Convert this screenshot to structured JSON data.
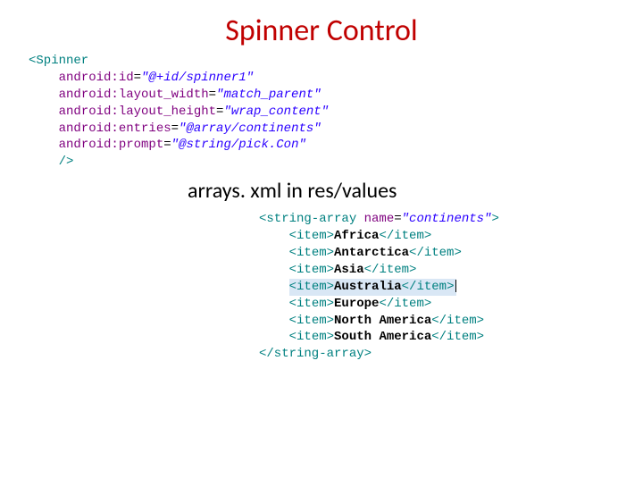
{
  "title": "Spinner Control",
  "subtitle": "arrays. xml in res/values",
  "spinner": {
    "open": "<Spinner",
    "attrs": [
      {
        "name": "android:id",
        "value": "\"@+id/spinner1\""
      },
      {
        "name": "android:layout_width",
        "value": "\"match_parent\""
      },
      {
        "name": "android:layout_height",
        "value": "\"wrap_content\""
      },
      {
        "name": "android:entries",
        "value": "\"@array/continents\""
      },
      {
        "name": "android:prompt",
        "value": "\"@string/pick.Con\""
      }
    ],
    "close": "/>"
  },
  "array": {
    "openTag": "<string-array",
    "nameAttr": "name",
    "nameVal": "\"continents\"",
    "openEnd": ">",
    "itemOpen": "<item>",
    "itemClose": "</item>",
    "items": [
      {
        "text": "Africa",
        "highlight": false
      },
      {
        "text": "Antarctica",
        "highlight": false
      },
      {
        "text": "Asia",
        "highlight": false
      },
      {
        "text": "Australia",
        "highlight": true
      },
      {
        "text": "Europe",
        "highlight": false
      },
      {
        "text": "North America",
        "highlight": false
      },
      {
        "text": "South America",
        "highlight": false
      }
    ],
    "closeTag": "</string-array>"
  }
}
